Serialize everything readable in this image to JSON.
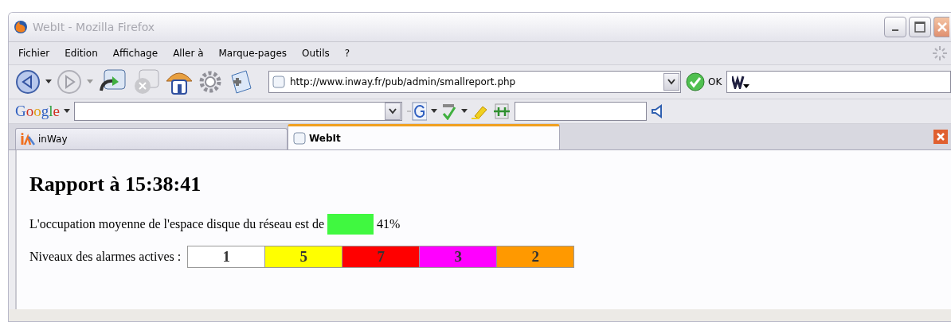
{
  "window": {
    "title": "WebIt - Mozilla Firefox"
  },
  "menu": [
    {
      "label": "Fichier"
    },
    {
      "label": "Edition"
    },
    {
      "label": "Affichage"
    },
    {
      "label": "Aller à"
    },
    {
      "label": "Marque-pages"
    },
    {
      "label": "Outils"
    },
    {
      "label": "?"
    }
  ],
  "address": {
    "value": "http://www.inway.fr/pub/admin/smallreport.php",
    "go_label": "OK"
  },
  "google_bar": {
    "brand": "Google"
  },
  "tabs": [
    {
      "label": "inWay",
      "selected": false
    },
    {
      "label": "WebIt",
      "selected": true
    }
  ],
  "page": {
    "heading": "Rapport à 15:38:41",
    "disk": {
      "text": "L'occupation moyenne de l'espace disque du réseau est de",
      "color": "#40f840",
      "value": "41%"
    },
    "alarms_label": "Niveaux des alarmes actives :",
    "alarms": [
      {
        "value": "1",
        "color": "#ffffff"
      },
      {
        "value": "5",
        "color": "#ffff00"
      },
      {
        "value": "7",
        "color": "#ff0000"
      },
      {
        "value": "3",
        "color": "#ff00ff"
      },
      {
        "value": "2",
        "color": "#ff9900"
      }
    ]
  }
}
